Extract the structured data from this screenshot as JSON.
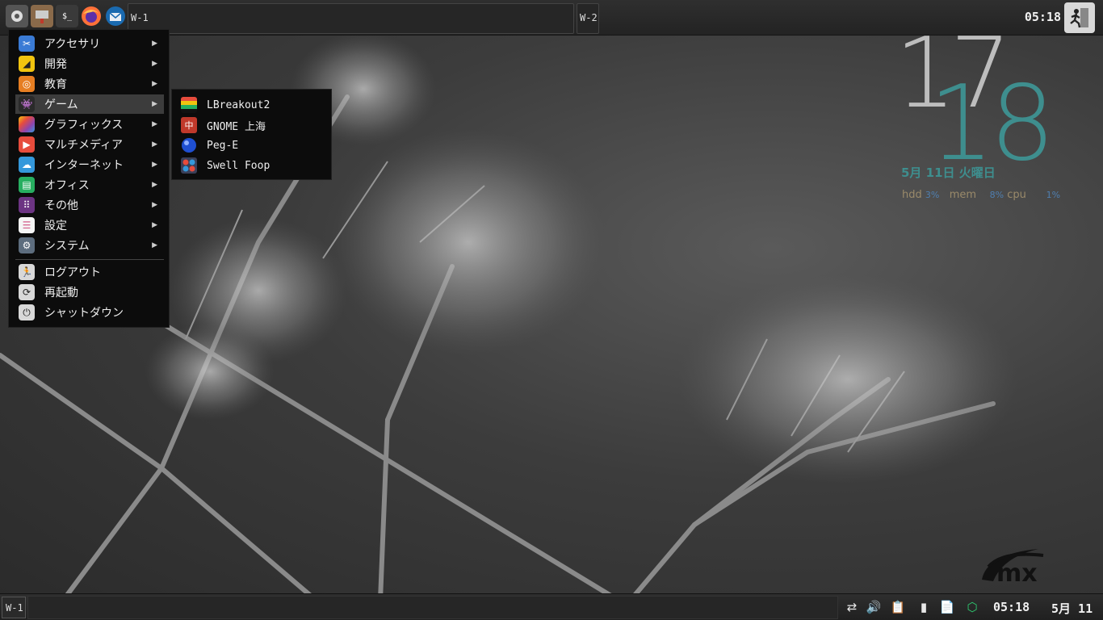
{
  "top_panel": {
    "launchers": [
      {
        "name": "settings-gear-icon"
      },
      {
        "name": "installer-icon"
      },
      {
        "name": "terminal-icon",
        "glyph": "$_"
      },
      {
        "name": "firefox-icon"
      },
      {
        "name": "thunderbird-icon"
      }
    ],
    "workspace_1": "W-1",
    "workspace_2": "W-2",
    "clock": "05:18"
  },
  "main_menu": {
    "items": [
      {
        "label": "アクセサリ",
        "icon": "scissors-icon",
        "color": "#3a7bd5"
      },
      {
        "label": "開発",
        "icon": "development-icon",
        "color": "#f1c40f"
      },
      {
        "label": "教育",
        "icon": "education-icon",
        "color": "#e67e22"
      },
      {
        "label": "ゲーム",
        "icon": "game-invader-icon",
        "color": "#333333"
      },
      {
        "label": "グラフィックス",
        "icon": "graphics-icon",
        "color": "#9b59b6"
      },
      {
        "label": "マルチメディア",
        "icon": "multimedia-play-icon",
        "color": "#e74c3c"
      },
      {
        "label": "インターネット",
        "icon": "cloud-icon",
        "color": "#3498db"
      },
      {
        "label": "オフィス",
        "icon": "office-icon",
        "color": "#27ae60"
      },
      {
        "label": "その他",
        "icon": "grid-icon",
        "color": "#8e44ad"
      },
      {
        "label": "設定",
        "icon": "toggle-settings-icon",
        "color": "#d35d8a"
      },
      {
        "label": "システム",
        "icon": "system-gear-icon",
        "color": "#5d6d7e"
      }
    ],
    "session": [
      {
        "label": "ログアウト",
        "icon": "logout-runner-icon"
      },
      {
        "label": "再起動",
        "icon": "reboot-icon"
      },
      {
        "label": "シャットダウン",
        "icon": "power-icon"
      }
    ]
  },
  "games_submenu": {
    "items": [
      {
        "label": "LBreakout2",
        "icon": "lbreakout-icon"
      },
      {
        "label": "GNOME 上海",
        "icon": "mahjongg-icon"
      },
      {
        "label": "Peg-E",
        "icon": "peg-ball-icon"
      },
      {
        "label": "Swell Foop",
        "icon": "swell-foop-icon"
      }
    ]
  },
  "conky": {
    "hour": "17",
    "minute": "18",
    "date": "5月 11日 火曜日",
    "hdd_label": "hdd",
    "hdd_value": "3%",
    "mem_label": "mem",
    "mem_value": "8%",
    "cpu_label": "cpu",
    "cpu_value": "1%"
  },
  "bottom_panel": {
    "workspace": "W-1",
    "time": "05:18",
    "date": "5月 11"
  },
  "colors": {
    "accent_teal": "#3e8e8e",
    "panel_bg": "#262626"
  }
}
